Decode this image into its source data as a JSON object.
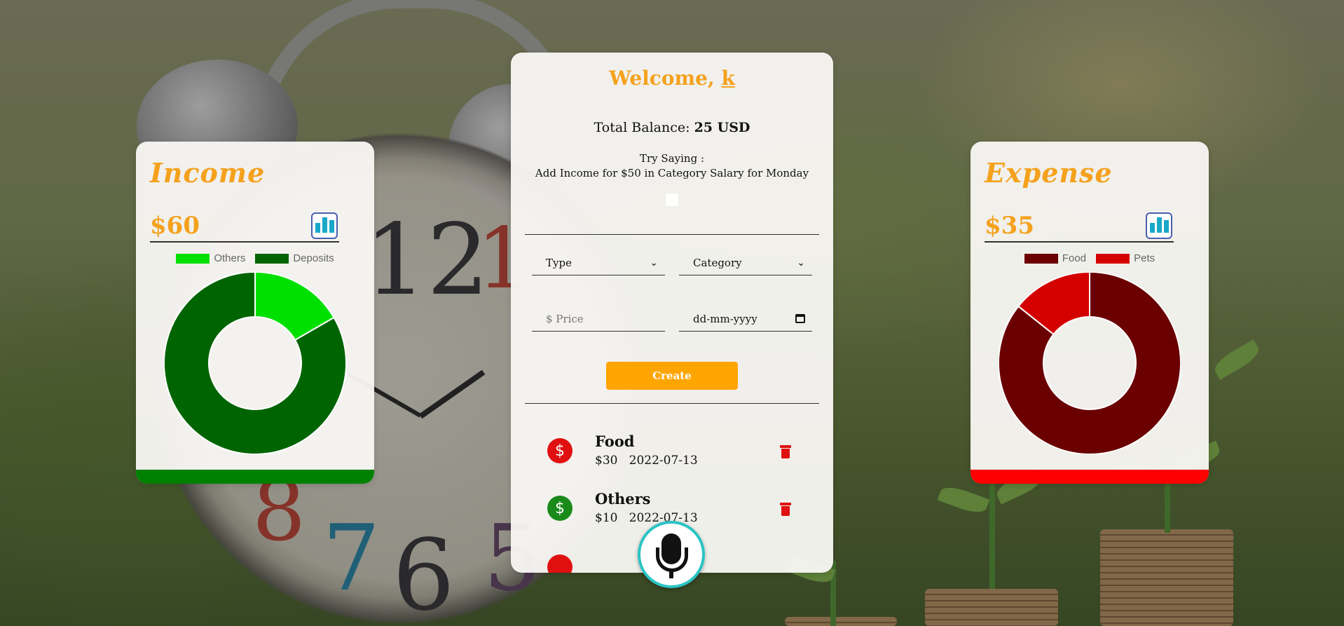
{
  "welcome": {
    "prefix": "Welcome, ",
    "username": "k"
  },
  "balance": {
    "label": "Total Balance: ",
    "value": "25 USD"
  },
  "hint": {
    "line1": "Try Saying :",
    "line2": "Add Income for $50 in Category Salary for Monday"
  },
  "form": {
    "type_label": "Type",
    "category_label": "Category",
    "price_placeholder": "$ Price",
    "date_placeholder": "dd-mm-yyyy",
    "create_label": "Create"
  },
  "income": {
    "title": "Income",
    "amount": "$60",
    "legend": [
      {
        "name": "Others",
        "color": "#00e000"
      },
      {
        "name": "Deposits",
        "color": "#006400"
      }
    ],
    "bar_color": "#008000"
  },
  "expense": {
    "title": "Expense",
    "amount": "$35",
    "legend": [
      {
        "name": "Food",
        "color": "#6b0000"
      },
      {
        "name": "Pets",
        "color": "#d40000"
      }
    ],
    "bar_color": "#ff0000"
  },
  "transactions": [
    {
      "category": "Food",
      "amount": "$30",
      "date": "2022-07-13",
      "type": "expense",
      "icon": "dollar-icon",
      "color": "#e01010"
    },
    {
      "category": "Others",
      "amount": "$10",
      "date": "2022-07-13",
      "type": "income",
      "icon": "dollar-icon",
      "color": "#1a8a1a"
    }
  ],
  "chart_data": [
    {
      "type": "pie",
      "title": "",
      "categories": [
        "Others",
        "Deposits"
      ],
      "values": [
        10,
        50
      ],
      "colors": [
        "#00e000",
        "#006400"
      ],
      "donut": true,
      "legend": "top"
    },
    {
      "type": "pie",
      "title": "",
      "categories": [
        "Food",
        "Pets"
      ],
      "values": [
        30,
        5
      ],
      "colors": [
        "#6b0000",
        "#d40000"
      ],
      "donut": true,
      "legend": "top"
    }
  ]
}
